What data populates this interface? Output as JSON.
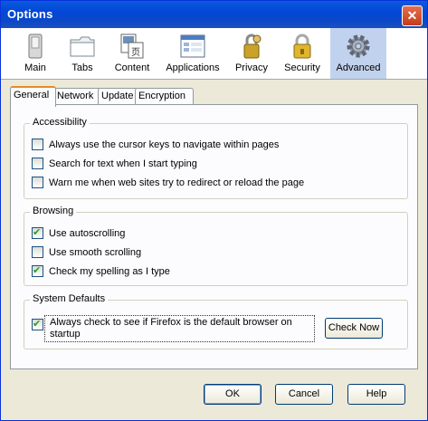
{
  "window": {
    "title": "Options"
  },
  "toolbar": {
    "items": [
      {
        "label": "Main",
        "icon": "main-icon"
      },
      {
        "label": "Tabs",
        "icon": "tabs-icon"
      },
      {
        "label": "Content",
        "icon": "content-icon"
      },
      {
        "label": "Applications",
        "icon": "applications-icon"
      },
      {
        "label": "Privacy",
        "icon": "privacy-icon"
      },
      {
        "label": "Security",
        "icon": "security-icon"
      },
      {
        "label": "Advanced",
        "icon": "gear-icon",
        "selected": true
      }
    ]
  },
  "tabs": [
    {
      "label": "General",
      "active": true
    },
    {
      "label": "Network"
    },
    {
      "label": "Update"
    },
    {
      "label": "Encryption"
    }
  ],
  "accessibility": {
    "legend": "Accessibility",
    "options": [
      {
        "label": "Always use the cursor keys to navigate within pages",
        "checked": false
      },
      {
        "label": "Search for text when I start typing",
        "checked": false
      },
      {
        "label": "Warn me when web sites try to redirect or reload the page",
        "checked": false
      }
    ]
  },
  "browsing": {
    "legend": "Browsing",
    "options": [
      {
        "label": "Use autoscrolling",
        "checked": true
      },
      {
        "label": "Use smooth scrolling",
        "checked": false
      },
      {
        "label": "Check my spelling as I type",
        "checked": true
      }
    ]
  },
  "system_defaults": {
    "legend": "System Defaults",
    "option_label": "Always check to see if Firefox is the default browser on startup",
    "checked": true,
    "check_now_label": "Check Now"
  },
  "buttons": {
    "ok": "OK",
    "cancel": "Cancel",
    "help": "Help"
  },
  "colors": {
    "titlebar": "#0346d6",
    "selected_tab_accent": "#e68b2c",
    "selected_toolbar_bg": "#c1d2ee"
  }
}
